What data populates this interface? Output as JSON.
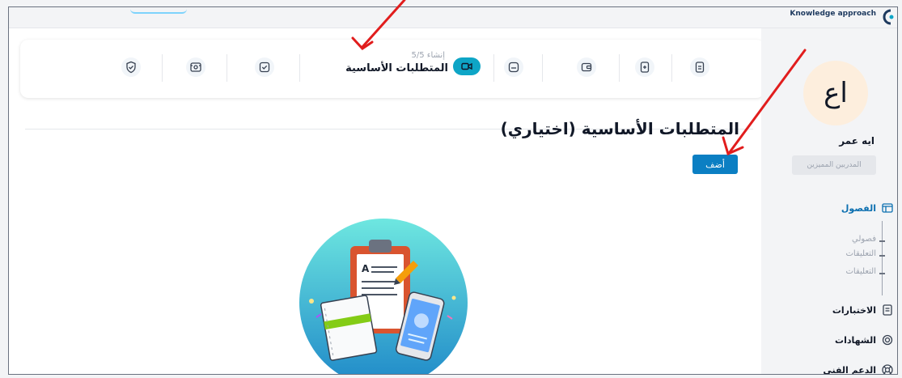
{
  "app": {
    "logo_line": "Knowledge approach"
  },
  "stepbar": {
    "active_step": {
      "subtitle": "إنشاء 5/5",
      "title": "المتطلبات الأساسية",
      "icon": "video-icon"
    },
    "steps": [
      {
        "icon": "shield-check-icon"
      },
      {
        "icon": "screen-capture-icon"
      },
      {
        "icon": "checkbox-icon"
      },
      {
        "icon": "folder-icon"
      },
      {
        "icon": "wallet-icon"
      },
      {
        "icon": "file-plus-icon"
      },
      {
        "icon": "document-icon"
      }
    ]
  },
  "main": {
    "title": "المتطلبات الأساسية (اختياري)",
    "add_button": "أضف",
    "illustration": "clipboard-notebook-phone-illustration"
  },
  "sidebar": {
    "avatar_initials": "اع",
    "user_name": "ايه عمر",
    "role": "المدربين المميزين",
    "sections_label": "الفصول",
    "sub_items": [
      "فصولي",
      "التعليقات",
      "التعليقات"
    ],
    "items": [
      {
        "label": "الاختبارات",
        "icon": "quiz-icon"
      },
      {
        "label": "الشهادات",
        "icon": "certificate-icon"
      },
      {
        "label": "الدعم الفني",
        "icon": "lifebuoy-icon"
      }
    ]
  },
  "colors": {
    "accent": "#0b7fc3",
    "active_badge": "#0ea5c6",
    "annotation_arrow": "#e11d1d"
  }
}
